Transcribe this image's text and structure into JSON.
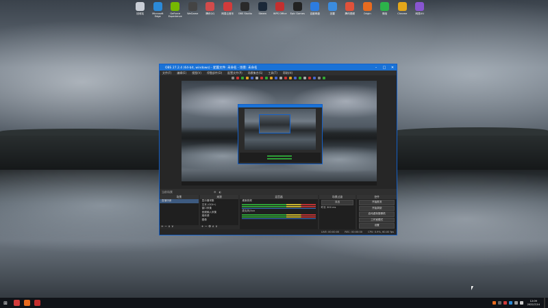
{
  "desktop_icons": [
    {
      "label": "回收站",
      "color": "#c9ced6"
    },
    {
      "label": "Microsoft Edge",
      "color": "#2b8ad8"
    },
    {
      "label": "GeForce Experience",
      "color": "#76b900"
    },
    {
      "label": "WeGame",
      "color": "#444444"
    },
    {
      "label": "腾讯QQ",
      "color": "#d24b4b"
    },
    {
      "label": "网易云音乐",
      "color": "#d23b3b"
    },
    {
      "label": "OBS Studio",
      "color": "#2a2a2a"
    },
    {
      "label": "Steam",
      "color": "#1b2838"
    },
    {
      "label": "WPS Office",
      "color": "#c42f2f"
    },
    {
      "label": "Epic Games",
      "color": "#222222"
    },
    {
      "label": "百度网盘",
      "color": "#2d7ce0"
    },
    {
      "label": "迅雷",
      "color": "#3b8cdf"
    },
    {
      "label": "腾讯视频",
      "color": "#e0513a"
    },
    {
      "label": "Origin",
      "color": "#e86b1f"
    },
    {
      "label": "微信",
      "color": "#2cb34a"
    },
    {
      "label": "Chrome",
      "color": "#e4a71a"
    },
    {
      "label": "网易UU",
      "color": "#8855d0"
    }
  ],
  "obs": {
    "title": "OBS 27.2.4 (64-bit, windows) - 配置文件: 未命名 - 场景: 未命名",
    "menu": [
      "文件(F)",
      "编辑(E)",
      "视图(V)",
      "停靠部件(D)",
      "配置文件(P)",
      "场景集合(S)",
      "工具(T)",
      "帮助(H)"
    ],
    "scene_bar": "当前场景",
    "docks": {
      "scenes": {
        "title": "场景",
        "items": [
          "直播场景"
        ]
      },
      "sources": {
        "title": "来源",
        "items": [
          "显示器采集",
          "文本 (GDI+)",
          "窗口采集",
          "音频输入采集",
          "媒体源",
          "图像"
        ]
      },
      "mixer": {
        "title": "混音器",
        "tracks": [
          "桌面音频",
          "麦克风/Aux"
        ]
      },
      "transitions": {
        "title": "场景过渡",
        "type": "淡出",
        "duration_label": "时长",
        "duration": "300 ms"
      },
      "controls": {
        "title": "控件",
        "buttons": [
          "开始推流",
          "开始录制",
          "启动虚拟摄像机",
          "工作室模式",
          "设置",
          "退出"
        ]
      }
    },
    "status": {
      "live": "LIVE: 00:00:00",
      "rec": "REC: 00:00:00",
      "cpu": "CPU: 0.9%, 60.00 fps"
    }
  },
  "taskbar": {
    "apps": [
      {
        "color": "#d23b3b"
      },
      {
        "color": "#e86b1f"
      },
      {
        "color": "#c42f2f"
      }
    ],
    "tray_colors": [
      "#e86b1f",
      "#666",
      "#d23b3b",
      "#2b8ad8",
      "#999",
      "#ccc"
    ],
    "time": "12:09",
    "date": "2022/7/14"
  }
}
